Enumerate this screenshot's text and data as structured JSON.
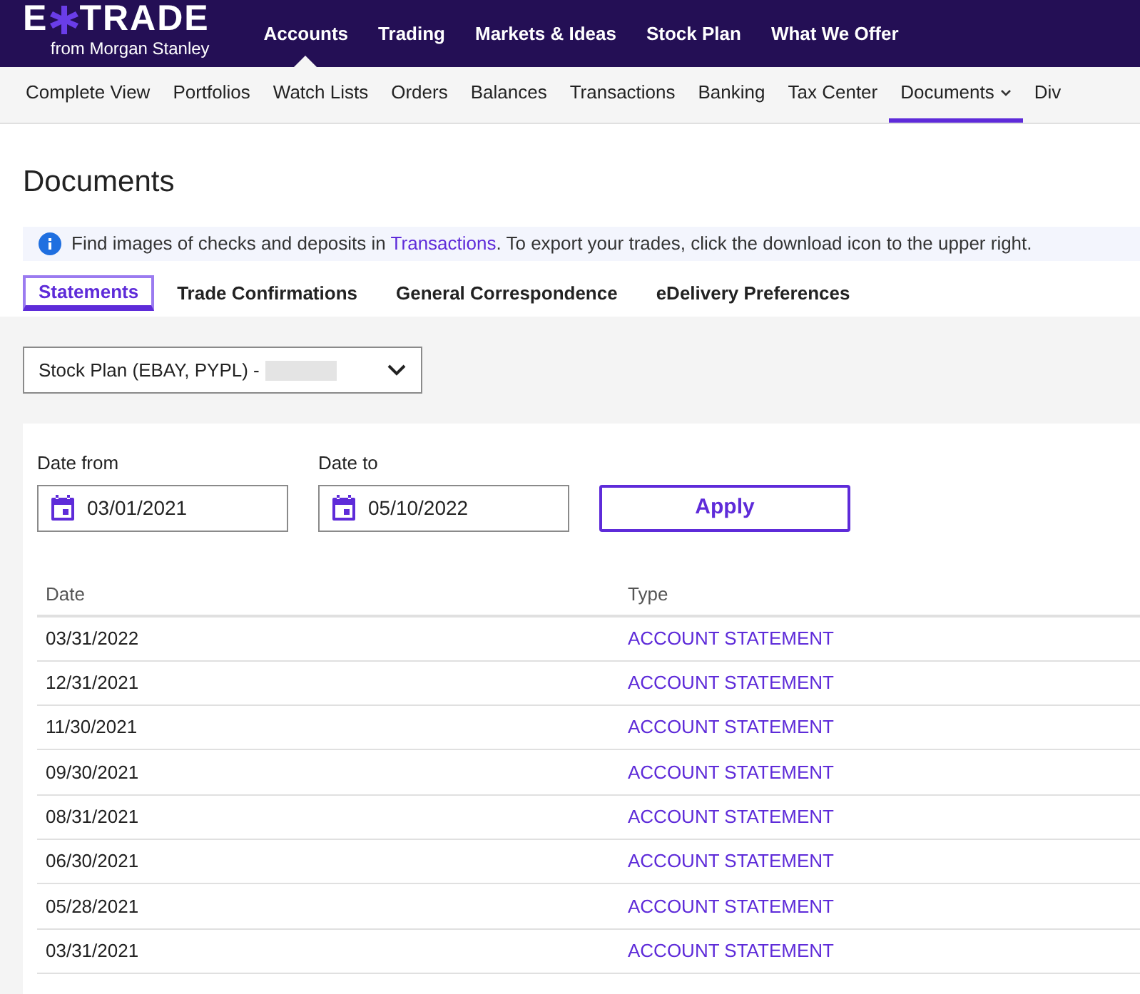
{
  "logo": {
    "left": "E",
    "right": "TRADE",
    "tagline": "from Morgan Stanley"
  },
  "main_nav": [
    {
      "label": "Accounts",
      "selected": true
    },
    {
      "label": "Trading",
      "selected": false
    },
    {
      "label": "Markets & Ideas",
      "selected": false
    },
    {
      "label": "Stock Plan",
      "selected": false
    },
    {
      "label": "What We Offer",
      "selected": false
    }
  ],
  "sub_nav": [
    {
      "label": "Complete View",
      "selected": false
    },
    {
      "label": "Portfolios",
      "selected": false
    },
    {
      "label": "Watch Lists",
      "selected": false
    },
    {
      "label": "Orders",
      "selected": false
    },
    {
      "label": "Balances",
      "selected": false
    },
    {
      "label": "Transactions",
      "selected": false
    },
    {
      "label": "Banking",
      "selected": false
    },
    {
      "label": "Tax Center",
      "selected": false
    },
    {
      "label": "Documents",
      "selected": true,
      "dropdown": true
    },
    {
      "label": "Div",
      "selected": false
    }
  ],
  "page_title": "Documents",
  "info_banner": {
    "before": "Find images of checks and deposits in",
    "link": "Transactions",
    "after": ". To export your trades, click the download icon to the upper right."
  },
  "tabs": [
    {
      "label": "Statements",
      "selected": true
    },
    {
      "label": "Trade Confirmations",
      "selected": false
    },
    {
      "label": "General Correspondence",
      "selected": false
    },
    {
      "label": "eDelivery Preferences",
      "selected": false
    }
  ],
  "account_select": {
    "value": "Stock Plan (EBAY, PYPL) -",
    "redacted": true
  },
  "date_from": {
    "label": "Date from",
    "value": "03/01/2021"
  },
  "date_to": {
    "label": "Date to",
    "value": "05/10/2022"
  },
  "apply_button": "Apply",
  "table": {
    "columns": [
      "Date",
      "Type"
    ],
    "rows": [
      {
        "date": "03/31/2022",
        "type": "ACCOUNT STATEMENT"
      },
      {
        "date": "12/31/2021",
        "type": "ACCOUNT STATEMENT"
      },
      {
        "date": "11/30/2021",
        "type": "ACCOUNT STATEMENT"
      },
      {
        "date": "09/30/2021",
        "type": "ACCOUNT STATEMENT"
      },
      {
        "date": "08/31/2021",
        "type": "ACCOUNT STATEMENT"
      },
      {
        "date": "06/30/2021",
        "type": "ACCOUNT STATEMENT"
      },
      {
        "date": "05/28/2021",
        "type": "ACCOUNT STATEMENT"
      },
      {
        "date": "03/31/2021",
        "type": "ACCOUNT STATEMENT"
      }
    ]
  }
}
